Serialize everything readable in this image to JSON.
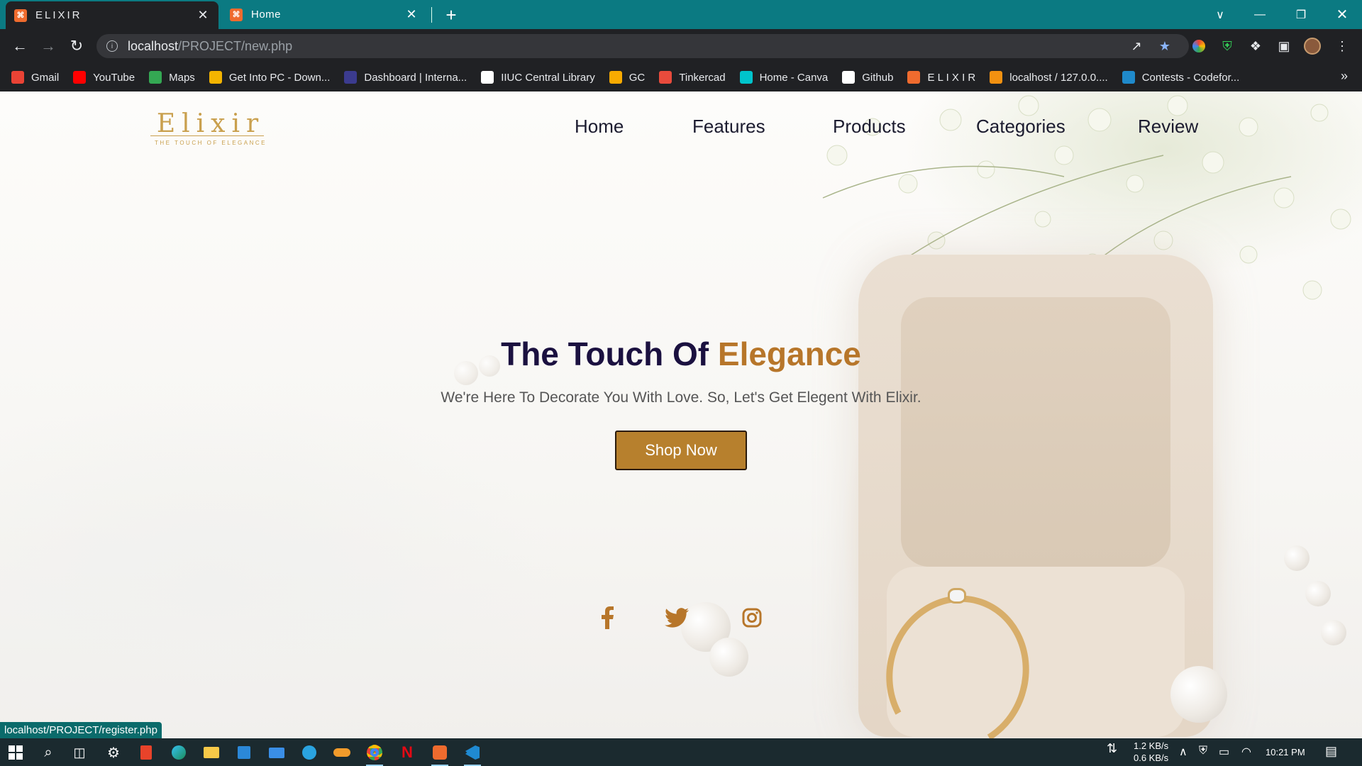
{
  "browser": {
    "tabs": [
      {
        "title": "ELIXIR",
        "active": true
      },
      {
        "title": "Home",
        "active": false
      }
    ],
    "url": {
      "host": "localhost",
      "path": "/PROJECT/new.php"
    },
    "bookmarks": [
      {
        "label": "Gmail",
        "icon": "gmail-icon",
        "color": "#ea4335"
      },
      {
        "label": "YouTube",
        "icon": "youtube-icon",
        "color": "#ff0000"
      },
      {
        "label": "Maps",
        "icon": "maps-icon",
        "color": "#34a853"
      },
      {
        "label": "Get Into PC - Down...",
        "icon": "getintopc-icon",
        "color": "#f4b400"
      },
      {
        "label": "Dashboard | Interna...",
        "icon": "university-icon",
        "color": "#3b3b8f"
      },
      {
        "label": "IIUC Central Library",
        "icon": "library-icon",
        "color": "#ffffff"
      },
      {
        "label": "GC",
        "icon": "classroom-icon",
        "color": "#f9ab00"
      },
      {
        "label": "Tinkercad",
        "icon": "tinkercad-icon",
        "color": "#e94b3c"
      },
      {
        "label": "Home - Canva",
        "icon": "canva-icon",
        "color": "#00c4cc"
      },
      {
        "label": "Github",
        "icon": "github-icon",
        "color": "#ffffff"
      },
      {
        "label": "E L I X I R",
        "icon": "xampp-icon",
        "color": "#ef6b2e"
      },
      {
        "label": "localhost / 127.0.0....",
        "icon": "phpmyadmin-icon",
        "color": "#f29111"
      },
      {
        "label": "Contests - Codefor...",
        "icon": "codeforces-icon",
        "color": "#1f8acb"
      }
    ]
  },
  "site": {
    "logo": {
      "brand": "Elixir",
      "tagline": "THE TOUCH OF ELEGANCE"
    },
    "nav": [
      "Home",
      "Features",
      "Products",
      "Categories",
      "Review"
    ],
    "hero": {
      "title_main": "The Touch Of ",
      "title_accent": "Elegance",
      "subtitle": "We're Here To Decorate You With Love. So, Let's Get Elegent With Elixir.",
      "cta": "Shop Now"
    },
    "social": [
      "facebook-icon",
      "twitter-icon",
      "instagram-icon"
    ],
    "colors": {
      "accent": "#b7762a",
      "title": "#1b1140",
      "button": "#b7802d"
    }
  },
  "status_url": "localhost/PROJECT/register.php",
  "taskbar": {
    "net_down": "1.2 KB/s",
    "net_up": "0.6 KB/s",
    "time": "10:21 PM"
  }
}
